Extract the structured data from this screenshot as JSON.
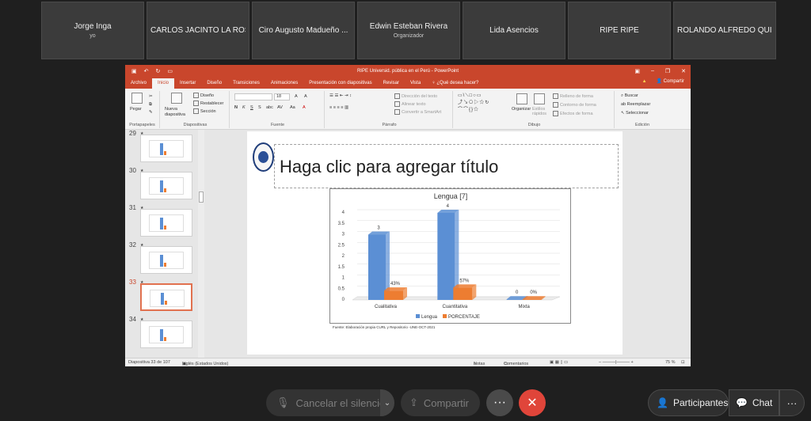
{
  "participants": [
    {
      "name": "Jorge Inga",
      "sub": "yo"
    },
    {
      "name": "CARLOS JACINTO LA ROS...",
      "sub": ""
    },
    {
      "name": "Ciro Augusto Madueño ...",
      "sub": ""
    },
    {
      "name": "Edwin Esteban Rivera",
      "sub": "Organizador"
    },
    {
      "name": "Lida Asencios",
      "sub": ""
    },
    {
      "name": "RIPE RIPE",
      "sub": ""
    },
    {
      "name": "ROLANDO ALFREDO QUI...",
      "sub": ""
    }
  ],
  "ppt": {
    "window_title": "RIPE Universid. pública en el Perú - PowerPoint",
    "tabs": [
      "Archivo",
      "Inicio",
      "Insertar",
      "Diseño",
      "Transiciones",
      "Animaciones",
      "Presentación con diapositivas",
      "Revisar",
      "Vista"
    ],
    "tell_me": "¿Qué desea hacer?",
    "share": "Compartir",
    "ribbon": {
      "paste": "Pegar",
      "new_slide": "Nueva diapositiva",
      "layout": "Diseño",
      "reset": "Restablecer",
      "section": "Sección",
      "font_size": "18",
      "text_direction": "Dirección del texto",
      "align_text": "Alinear texto",
      "convert_smartart": "Convertir a SmartArt",
      "arrange": "Organizar",
      "quick_styles": "Estilos rápidos",
      "shape_fill": "Relleno de forma",
      "shape_outline": "Contorno de forma",
      "shape_effects": "Efectos de forma",
      "find": "Buscar",
      "replace": "Reemplazar",
      "select": "Seleccionar",
      "groups": {
        "clipboard": "Portapapeles",
        "slides": "Diapositivas",
        "font": "Fuente",
        "paragraph": "Párrafo",
        "drawing": "Dibujo",
        "editing": "Edición"
      }
    },
    "thumbnails": [
      "29",
      "30",
      "31",
      "32",
      "33",
      "34"
    ],
    "selected_thumbnail": "33",
    "slide_title": "Haga clic para agregar título",
    "source_note": "Fuente: Elaboración propia CURL y Repositorio -UNE-OCT-2021",
    "status": {
      "slide_info": "Diapositiva 33 de 107",
      "language": "Inglés (Estados Unidos)",
      "notes": "Notas",
      "comments": "Comentarios",
      "zoom": "75 %"
    }
  },
  "chart_data": {
    "type": "bar",
    "title": "Lengua [7]",
    "categories": [
      "Cualitativa",
      "Cuantitativa",
      "Mixta"
    ],
    "series": [
      {
        "name": "Lengua",
        "values": [
          3,
          4,
          0
        ],
        "labels": [
          "3",
          "4",
          "0"
        ]
      },
      {
        "name": "PORCENTAJE",
        "values": [
          0.43,
          0.57,
          0
        ],
        "labels": [
          "43%",
          "57%",
          "0%"
        ]
      }
    ],
    "yticks": [
      "0",
      "0.5",
      "1",
      "1.5",
      "2",
      "2.5",
      "3",
      "3.5",
      "4"
    ],
    "ylim": [
      0,
      4
    ],
    "grid": true,
    "legend": "bottom",
    "colors": {
      "Lengua": "#5b8fd4",
      "PORCENTAJE": "#ed7d31"
    }
  },
  "controls": {
    "mute": "Cancelar el silencio",
    "share": "Compartir",
    "participants": "Participantes",
    "chat": "Chat"
  }
}
